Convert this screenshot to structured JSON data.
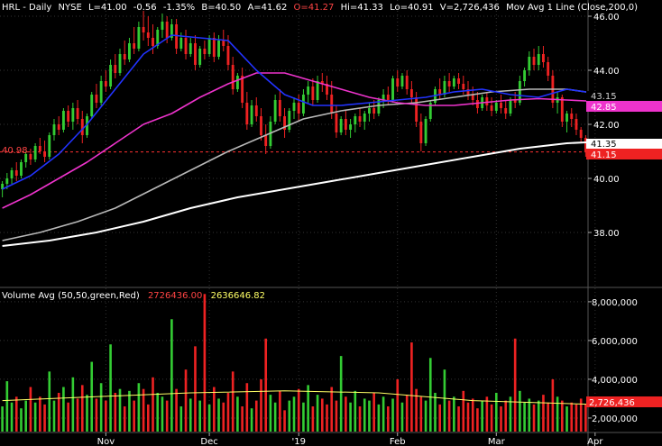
{
  "title_bar": {
    "symbol": "HRL",
    "period": "Daily",
    "exchange": "NYSE",
    "last": "L=41.00",
    "change": "-0.56",
    "change_pct": "-1.35%",
    "bid": "B=40.50",
    "ask": "A=41.62",
    "open": "O=41.27",
    "high": "Hi=41.33",
    "low": "Lo=40.91",
    "volume": "V=2,726,436",
    "study": "Mov Avg 1 Line (Close,200,0)"
  },
  "volume_bar": {
    "label": "Volume Avg (50,50,green,Red)",
    "value1": "2726436.00",
    "value2": "2636646.82"
  },
  "colors": {
    "background": "#000000",
    "up": "#33cc33",
    "down": "#ee2222",
    "ma_blue": "#2233ff",
    "ma_magenta": "#ee33cc",
    "ma_gray": "#b8b8b8",
    "ma_white": "#ffffff",
    "vol_avg": "#ffff66",
    "ref_line": "#ff3333",
    "grid": "#333333"
  },
  "price_tags": {
    "ref_left": "40.98",
    "blue_gray": "43.15",
    "magenta": "42.85",
    "white": "41.35",
    "last": "41.15",
    "volume": "2,726,436"
  },
  "chart_data": [
    {
      "type": "candlestick",
      "title": "HRL - Daily",
      "y_ticks": [
        "46.00",
        "44.00",
        "42.00",
        "40.00",
        "38.00"
      ],
      "ylim": [
        36.0,
        46.6
      ],
      "x_ticks": [
        "Nov",
        "Dec",
        "'19",
        "Feb",
        "Mar",
        "Apr"
      ],
      "x_tick_index": [
        22,
        44,
        63,
        84,
        105,
        126
      ],
      "reference_line": 40.98,
      "ohlc": [
        [
          39.6,
          39.9,
          39.3,
          39.8
        ],
        [
          39.8,
          40.2,
          39.6,
          40.0
        ],
        [
          40.0,
          40.4,
          39.8,
          40.3
        ],
        [
          40.3,
          40.6,
          39.9,
          40.1
        ],
        [
          40.1,
          40.7,
          40.0,
          40.6
        ],
        [
          40.6,
          41.0,
          40.4,
          40.9
        ],
        [
          40.9,
          41.1,
          40.5,
          40.7
        ],
        [
          40.7,
          41.3,
          40.6,
          41.2
        ],
        [
          41.2,
          41.5,
          40.9,
          41.0
        ],
        [
          41.0,
          41.4,
          40.6,
          40.8
        ],
        [
          40.8,
          41.7,
          40.7,
          41.6
        ],
        [
          41.6,
          42.2,
          41.4,
          42.0
        ],
        [
          42.0,
          42.3,
          41.6,
          41.8
        ],
        [
          41.8,
          42.6,
          41.7,
          42.5
        ],
        [
          42.5,
          42.7,
          41.9,
          42.1
        ],
        [
          42.1,
          42.8,
          41.8,
          42.6
        ],
        [
          42.6,
          42.9,
          42.0,
          42.2
        ],
        [
          42.2,
          42.5,
          41.3,
          41.6
        ],
        [
          41.6,
          42.4,
          41.5,
          42.3
        ],
        [
          42.3,
          43.2,
          42.2,
          43.1
        ],
        [
          43.1,
          43.5,
          42.6,
          42.8
        ],
        [
          42.8,
          43.8,
          42.7,
          43.6
        ],
        [
          43.6,
          44.0,
          43.2,
          43.4
        ],
        [
          43.4,
          44.4,
          43.3,
          44.2
        ],
        [
          44.2,
          44.6,
          43.7,
          43.9
        ],
        [
          43.9,
          44.8,
          43.8,
          44.6
        ],
        [
          44.6,
          45.1,
          44.2,
          44.4
        ],
        [
          44.4,
          45.2,
          44.3,
          45.0
        ],
        [
          45.0,
          45.6,
          44.6,
          44.8
        ],
        [
          44.8,
          45.8,
          44.7,
          45.6
        ],
        [
          45.6,
          46.2,
          45.1,
          45.4
        ],
        [
          45.4,
          46.0,
          44.9,
          45.2
        ],
        [
          45.2,
          45.7,
          44.6,
          44.9
        ],
        [
          44.9,
          45.6,
          44.8,
          45.5
        ],
        [
          45.5,
          46.1,
          45.2,
          45.8
        ],
        [
          45.8,
          46.0,
          45.0,
          45.2
        ],
        [
          45.2,
          45.9,
          45.1,
          45.7
        ],
        [
          45.7,
          45.9,
          44.6,
          44.8
        ],
        [
          44.8,
          45.4,
          44.7,
          45.2
        ],
        [
          45.2,
          45.5,
          44.4,
          44.6
        ],
        [
          44.6,
          45.2,
          44.5,
          45.0
        ],
        [
          45.0,
          45.3,
          44.0,
          44.2
        ],
        [
          44.2,
          44.9,
          44.1,
          44.8
        ],
        [
          44.8,
          45.1,
          44.4,
          44.6
        ],
        [
          44.6,
          45.3,
          44.5,
          45.2
        ],
        [
          45.2,
          45.4,
          44.3,
          44.5
        ],
        [
          44.5,
          45.3,
          44.4,
          45.1
        ],
        [
          45.1,
          45.5,
          44.7,
          44.9
        ],
        [
          44.9,
          45.3,
          44.0,
          44.2
        ],
        [
          44.2,
          44.5,
          43.1,
          43.3
        ],
        [
          43.3,
          43.9,
          43.2,
          43.8
        ],
        [
          43.8,
          44.1,
          42.6,
          42.8
        ],
        [
          42.8,
          43.2,
          41.8,
          42.0
        ],
        [
          42.0,
          42.9,
          41.9,
          42.7
        ],
        [
          42.7,
          43.0,
          42.1,
          42.3
        ],
        [
          42.3,
          42.6,
          41.4,
          41.6
        ],
        [
          41.6,
          42.0,
          40.9,
          41.2
        ],
        [
          41.2,
          42.3,
          41.1,
          42.1
        ],
        [
          42.1,
          43.1,
          42.0,
          42.9
        ],
        [
          42.9,
          43.3,
          42.1,
          42.3
        ],
        [
          42.3,
          42.6,
          41.5,
          41.8
        ],
        [
          41.8,
          42.6,
          41.7,
          42.5
        ],
        [
          42.5,
          43.0,
          42.2,
          42.8
        ],
        [
          42.8,
          43.1,
          42.1,
          42.4
        ],
        [
          42.4,
          43.3,
          42.3,
          43.1
        ],
        [
          43.1,
          43.6,
          42.8,
          43.4
        ],
        [
          43.4,
          43.7,
          42.7,
          42.9
        ],
        [
          42.9,
          43.8,
          42.8,
          43.6
        ],
        [
          43.6,
          43.9,
          43.2,
          43.5
        ],
        [
          43.5,
          43.8,
          42.9,
          43.1
        ],
        [
          43.1,
          43.6,
          42.2,
          42.4
        ],
        [
          42.4,
          42.7,
          41.5,
          41.7
        ],
        [
          41.7,
          42.3,
          41.6,
          42.2
        ],
        [
          42.2,
          42.5,
          41.6,
          41.8
        ],
        [
          41.8,
          42.2,
          41.5,
          42.0
        ],
        [
          42.0,
          42.4,
          41.7,
          42.3
        ],
        [
          42.3,
          42.6,
          41.9,
          42.1
        ],
        [
          42.1,
          42.5,
          41.8,
          42.4
        ],
        [
          42.4,
          42.8,
          42.1,
          42.6
        ],
        [
          42.6,
          42.9,
          42.2,
          42.4
        ],
        [
          42.4,
          43.0,
          42.3,
          42.9
        ],
        [
          42.9,
          43.3,
          42.6,
          43.1
        ],
        [
          43.1,
          43.4,
          42.7,
          42.9
        ],
        [
          42.9,
          43.8,
          42.8,
          43.7
        ],
        [
          43.7,
          44.0,
          43.2,
          43.4
        ],
        [
          43.4,
          43.9,
          43.3,
          43.8
        ],
        [
          43.8,
          44.0,
          43.1,
          43.3
        ],
        [
          43.3,
          43.6,
          42.8,
          43.0
        ],
        [
          43.0,
          43.2,
          41.9,
          42.1
        ],
        [
          42.1,
          42.4,
          41.0,
          41.3
        ],
        [
          41.3,
          42.3,
          41.2,
          42.2
        ],
        [
          42.2,
          42.9,
          42.1,
          42.8
        ],
        [
          42.8,
          43.4,
          42.7,
          43.3
        ],
        [
          43.3,
          43.7,
          42.9,
          43.1
        ],
        [
          43.1,
          43.8,
          43.0,
          43.6
        ],
        [
          43.6,
          43.9,
          43.2,
          43.4
        ],
        [
          43.4,
          43.8,
          43.3,
          43.7
        ],
        [
          43.7,
          43.9,
          43.3,
          43.5
        ],
        [
          43.5,
          43.8,
          43.1,
          43.3
        ],
        [
          43.3,
          43.6,
          42.9,
          43.1
        ],
        [
          43.1,
          43.4,
          42.7,
          42.9
        ],
        [
          42.9,
          43.2,
          42.4,
          42.6
        ],
        [
          42.6,
          43.1,
          42.5,
          43.0
        ],
        [
          43.0,
          43.2,
          42.5,
          42.7
        ],
        [
          42.7,
          43.0,
          42.3,
          42.5
        ],
        [
          42.5,
          42.9,
          42.4,
          42.8
        ],
        [
          42.8,
          43.1,
          42.4,
          42.6
        ],
        [
          42.6,
          42.9,
          42.2,
          42.4
        ],
        [
          42.4,
          43.0,
          42.3,
          42.9
        ],
        [
          42.9,
          43.2,
          42.6,
          42.8
        ],
        [
          42.8,
          43.8,
          42.7,
          43.6
        ],
        [
          43.6,
          44.1,
          43.4,
          44.0
        ],
        [
          44.0,
          44.7,
          43.8,
          44.5
        ],
        [
          44.5,
          44.8,
          44.0,
          44.2
        ],
        [
          44.2,
          44.9,
          44.0,
          44.6
        ],
        [
          44.6,
          44.9,
          44.1,
          44.3
        ],
        [
          44.3,
          44.5,
          43.6,
          43.8
        ],
        [
          43.8,
          44.0,
          42.6,
          42.8
        ],
        [
          42.8,
          43.2,
          42.4,
          43.0
        ],
        [
          43.0,
          43.1,
          41.9,
          42.1
        ],
        [
          42.1,
          42.5,
          41.7,
          42.4
        ],
        [
          42.4,
          42.6,
          41.9,
          42.2
        ],
        [
          42.2,
          42.4,
          41.6,
          41.8
        ],
        [
          41.8,
          41.9,
          41.3,
          41.5
        ],
        [
          41.5,
          41.6,
          40.8,
          41.0
        ]
      ],
      "ma_blue": [
        [
          0,
          39.6
        ],
        [
          6,
          40.1
        ],
        [
          12,
          40.9
        ],
        [
          18,
          42.0
        ],
        [
          24,
          43.3
        ],
        [
          30,
          44.6
        ],
        [
          36,
          45.3
        ],
        [
          42,
          45.2
        ],
        [
          48,
          45.1
        ],
        [
          54,
          44.0
        ],
        [
          60,
          43.1
        ],
        [
          66,
          42.7
        ],
        [
          72,
          42.7
        ],
        [
          78,
          42.8
        ],
        [
          84,
          42.9
        ],
        [
          90,
          43.0
        ],
        [
          96,
          43.2
        ],
        [
          102,
          43.3
        ],
        [
          108,
          43.1
        ],
        [
          114,
          43.0
        ],
        [
          120,
          43.3
        ],
        [
          126,
          43.15
        ]
      ],
      "ma_magenta": [
        [
          0,
          38.9
        ],
        [
          6,
          39.4
        ],
        [
          12,
          40.0
        ],
        [
          18,
          40.6
        ],
        [
          24,
          41.3
        ],
        [
          30,
          42.0
        ],
        [
          36,
          42.4
        ],
        [
          42,
          43.0
        ],
        [
          48,
          43.5
        ],
        [
          54,
          43.9
        ],
        [
          60,
          43.9
        ],
        [
          66,
          43.6
        ],
        [
          72,
          43.3
        ],
        [
          78,
          43.0
        ],
        [
          84,
          42.8
        ],
        [
          90,
          42.7
        ],
        [
          96,
          42.7
        ],
        [
          102,
          42.8
        ],
        [
          108,
          42.9
        ],
        [
          114,
          42.95
        ],
        [
          120,
          42.9
        ],
        [
          126,
          42.85
        ]
      ],
      "ma_gray": [
        [
          0,
          37.7
        ],
        [
          8,
          38.0
        ],
        [
          16,
          38.4
        ],
        [
          24,
          38.9
        ],
        [
          32,
          39.6
        ],
        [
          40,
          40.3
        ],
        [
          48,
          41.0
        ],
        [
          56,
          41.6
        ],
        [
          64,
          42.2
        ],
        [
          72,
          42.5
        ],
        [
          80,
          42.7
        ],
        [
          88,
          42.8
        ],
        [
          96,
          43.0
        ],
        [
          104,
          43.2
        ],
        [
          112,
          43.3
        ],
        [
          120,
          43.3
        ],
        [
          126,
          43.15
        ]
      ],
      "ma_white": [
        [
          0,
          37.5
        ],
        [
          10,
          37.7
        ],
        [
          20,
          38.0
        ],
        [
          30,
          38.4
        ],
        [
          40,
          38.9
        ],
        [
          50,
          39.3
        ],
        [
          60,
          39.6
        ],
        [
          70,
          39.9
        ],
        [
          80,
          40.2
        ],
        [
          90,
          40.5
        ],
        [
          100,
          40.8
        ],
        [
          110,
          41.1
        ],
        [
          120,
          41.3
        ],
        [
          126,
          41.35
        ]
      ]
    },
    {
      "type": "bar",
      "title": "Volume Avg (50,50,green,Red)",
      "y_ticks": [
        "8,000,000",
        "6,000,000",
        "4,000,000",
        "2,000,000"
      ],
      "ylim": [
        1300000,
        8600000
      ],
      "volumes_millions": [
        2.6,
        3.9,
        2.8,
        3.1,
        2.5,
        2.9,
        3.6,
        2.8,
        3.1,
        2.7,
        4.4,
        2.9,
        3.3,
        3.6,
        2.8,
        4.1,
        3.0,
        3.7,
        3.2,
        4.9,
        3.0,
        3.8,
        2.9,
        5.8,
        3.3,
        3.5,
        2.6,
        3.4,
        2.9,
        3.8,
        3.5,
        2.7,
        4.1,
        3.3,
        3.1,
        2.9,
        7.1,
        3.5,
        2.6,
        4.5,
        3.0,
        5.7,
        2.9,
        8.4,
        2.7,
        3.6,
        3.0,
        2.8,
        3.3,
        4.4,
        3.1,
        2.6,
        3.8,
        2.5,
        2.9,
        4.0,
        6.1,
        3.2,
        2.8,
        3.4,
        2.4,
        2.9,
        3.1,
        3.5,
        2.8,
        3.7,
        2.6,
        3.2,
        3.0,
        2.7,
        3.6,
        2.9,
        5.2,
        3.1,
        2.8,
        3.4,
        2.6,
        3.0,
        2.9,
        3.3,
        2.7,
        3.1,
        2.6,
        3.0,
        4.0,
        2.8,
        3.2,
        5.9,
        3.5,
        3.1,
        2.9,
        5.1,
        3.3,
        2.7,
        4.5,
        2.9,
        3.1,
        2.6,
        3.4,
        2.8,
        3.0,
        2.5,
        2.9,
        3.1,
        2.7,
        3.3,
        2.6,
        2.9,
        3.1,
        6.1,
        3.4,
        2.8,
        3.0,
        2.7,
        2.9,
        3.2,
        2.8,
        4.0,
        3.1,
        2.9,
        2.6,
        2.8,
        2.7,
        3.0,
        2.7
      ],
      "avg_millions": [
        [
          0,
          2.9
        ],
        [
          20,
          3.1
        ],
        [
          40,
          3.3
        ],
        [
          60,
          3.4
        ],
        [
          80,
          3.3
        ],
        [
          100,
          2.9
        ],
        [
          126,
          2.7
        ]
      ]
    }
  ]
}
